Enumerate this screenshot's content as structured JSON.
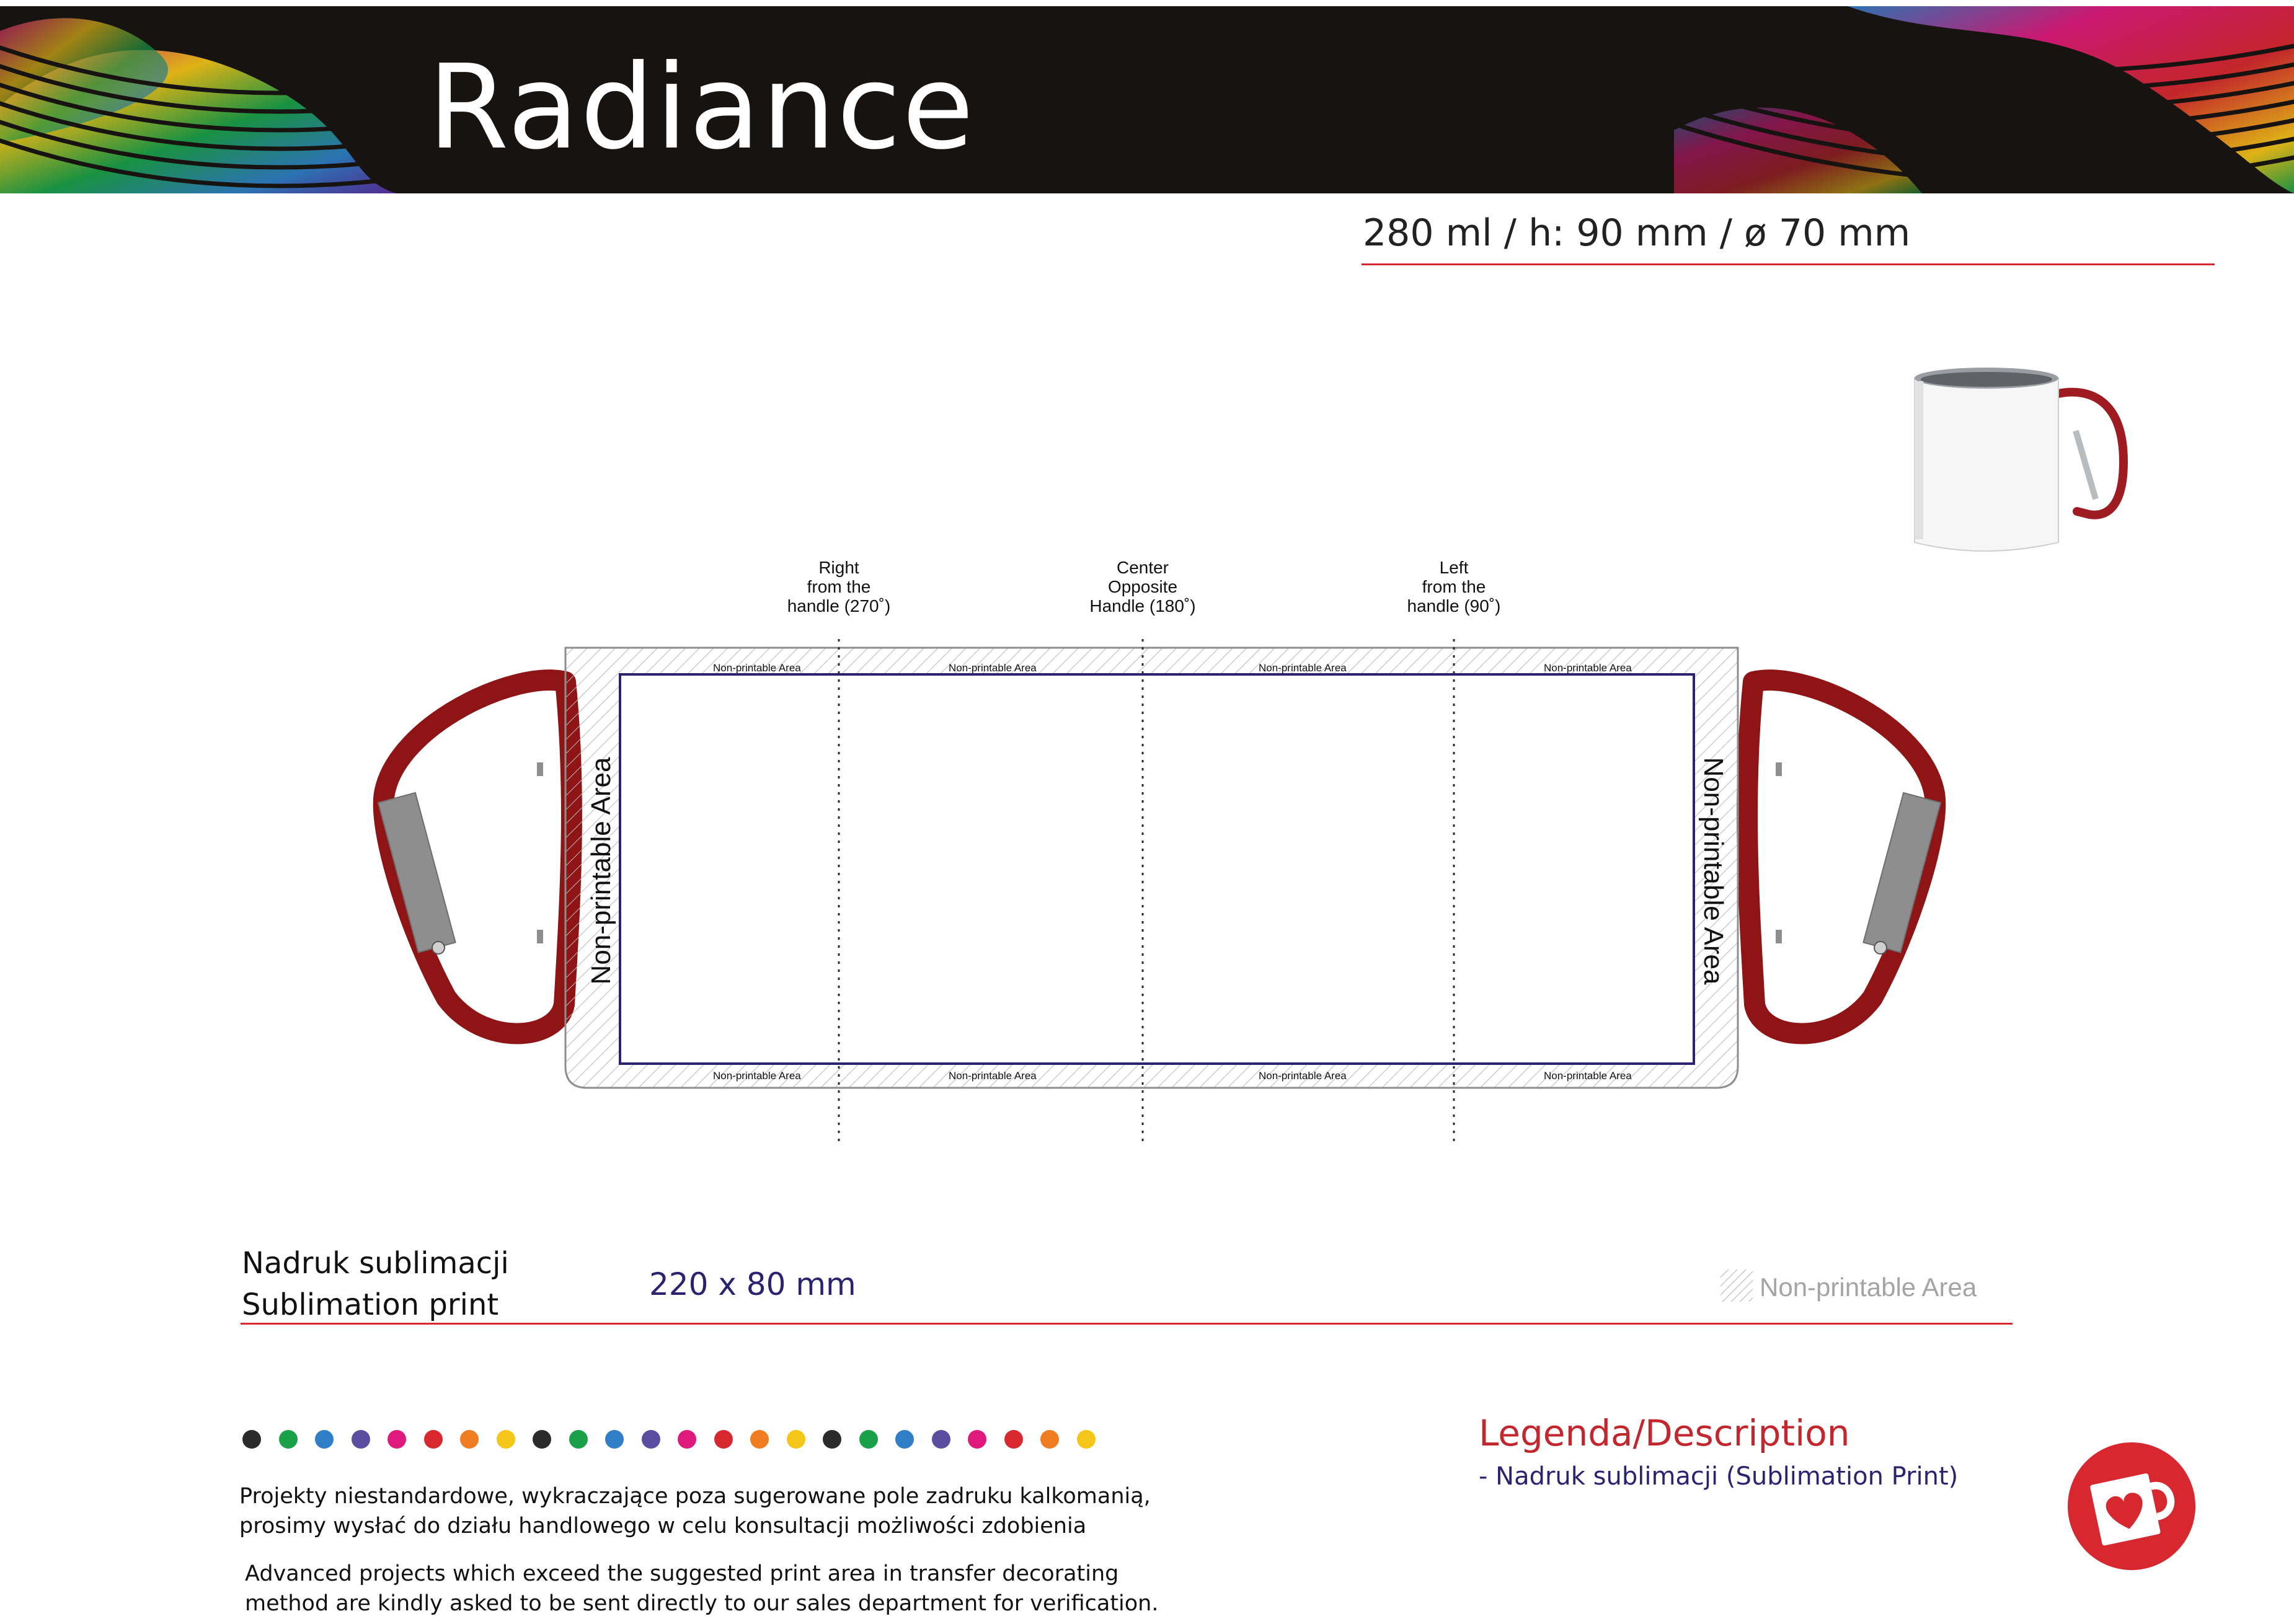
{
  "header": {
    "title": "Radiance"
  },
  "product": {
    "specs": "280 ml / h: 90 mm / ø 70 mm"
  },
  "template": {
    "positions": [
      {
        "label": "Right\nfrom the\nhandle (270˚)"
      },
      {
        "label": "Center\nOpposite\nHandle (180˚)"
      },
      {
        "label": "Left\nfrom the\nhandle (90˚)"
      }
    ],
    "non_printable_small": "Non-printable Area",
    "non_printable_left": "Non-printable Area",
    "non_printable_right": "Non-printable Area"
  },
  "print_info": {
    "label_pl": "Nadruk sublimacji",
    "label_en": "Sublimation print",
    "size": "220 x 80 mm",
    "legend_non_printable": "Non-printable Area"
  },
  "colors": {
    "accent_red": "#d7282f",
    "navy": "#2b2370",
    "handle_red": "#8f1416",
    "swatches": [
      "#2b2b2b",
      "#1aa049",
      "#2f7ec6",
      "#5b4d9f",
      "#e0197d",
      "#d7282f",
      "#f07d22",
      "#f5c518",
      "#2b2b2b",
      "#1aa049",
      "#2f7ec6",
      "#5b4d9f",
      "#e0197d",
      "#d7282f",
      "#f07d22",
      "#f5c518",
      "#2b2b2b",
      "#1aa049",
      "#2f7ec6",
      "#5b4d9f",
      "#e0197d",
      "#d7282f",
      "#f07d22",
      "#f5c518"
    ]
  },
  "notes": {
    "pl_line1": "Projekty niestandardowe, wykraczające poza sugerowane pole zadruku kalkomanią,",
    "pl_line2": "prosimy wysłać do działu handlowego w celu konsultacji możliwości zdobienia",
    "en_line1": "Advanced projects which exceed the suggested  print area in transfer decorating",
    "en_line2": "method are kindly asked to be sent directly to our sales department for verification."
  },
  "description": {
    "title": "Legenda/Description",
    "item": "- Nadruk sublimacji (Sublimation Print)"
  },
  "icons": {
    "product_photo": "mug-with-carabiner-image",
    "logo": "heart-mug-logo-icon",
    "hatch": "hatch-swatch-icon"
  }
}
